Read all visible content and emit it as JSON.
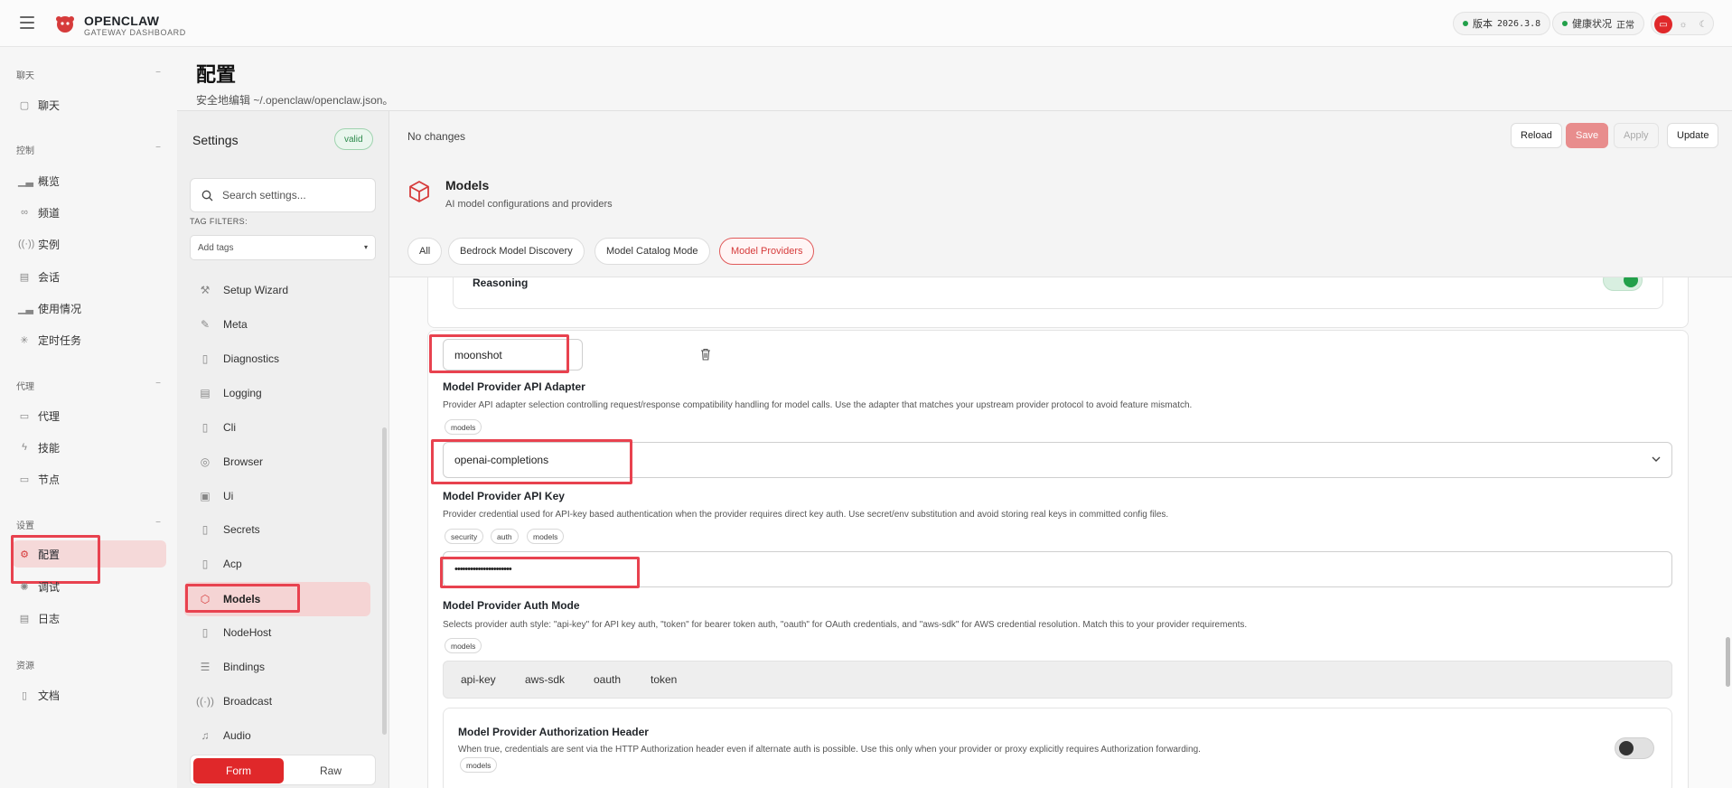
{
  "app": {
    "brand": "OPENCLAW",
    "brand_sub": "GATEWAY DASHBOARD"
  },
  "topbar": {
    "version_label": "版本",
    "version_value": "2026.3.8",
    "health_label": "健康状况",
    "health_value": "正常"
  },
  "nav": {
    "sections": [
      {
        "label": "聊天",
        "toggle": "−"
      },
      {
        "label": "控制",
        "toggle": "−"
      },
      {
        "label": "代理",
        "toggle": "−"
      },
      {
        "label": "设置",
        "toggle": "−"
      },
      {
        "label": "资源"
      }
    ],
    "items": [
      {
        "label": "聊天",
        "icon": "chat-icon"
      },
      {
        "label": "概览",
        "icon": "bar-chart-icon"
      },
      {
        "label": "频道",
        "icon": "link-icon"
      },
      {
        "label": "实例",
        "icon": "broadcast-icon"
      },
      {
        "label": "会话",
        "icon": "document-icon"
      },
      {
        "label": "使用情况",
        "icon": "bar-chart-icon"
      },
      {
        "label": "定时任务",
        "icon": "loader-icon"
      },
      {
        "label": "代理",
        "icon": "folder-icon"
      },
      {
        "label": "技能",
        "icon": "bolt-icon"
      },
      {
        "label": "节点",
        "icon": "monitor-icon"
      },
      {
        "label": "配置",
        "icon": "gear-icon",
        "active": true
      },
      {
        "label": "调试",
        "icon": "bug-icon"
      },
      {
        "label": "日志",
        "icon": "log-icon"
      },
      {
        "label": "文档",
        "icon": "book-icon"
      }
    ]
  },
  "page": {
    "title": "配置",
    "subtitle": "安全地编辑 ~/.openclaw/openclaw.json。"
  },
  "settings": {
    "title": "Settings",
    "status": "valid",
    "search_placeholder": "Search settings...",
    "tag_filters_label": "TAG FILTERS:",
    "add_tags": "Add tags",
    "items": [
      {
        "label": "Setup Wizard",
        "icon": "wand-icon"
      },
      {
        "label": "Meta",
        "icon": "pencil-icon"
      },
      {
        "label": "Diagnostics",
        "icon": "file-icon"
      },
      {
        "label": "Logging",
        "icon": "file-text-icon"
      },
      {
        "label": "Cli",
        "icon": "file-icon"
      },
      {
        "label": "Browser",
        "icon": "chrome-icon"
      },
      {
        "label": "Ui",
        "icon": "layout-icon"
      },
      {
        "label": "Secrets",
        "icon": "file-icon"
      },
      {
        "label": "Acp",
        "icon": "file-icon"
      },
      {
        "label": "Models",
        "icon": "cube-icon",
        "active": true
      },
      {
        "label": "NodeHost",
        "icon": "file-icon"
      },
      {
        "label": "Bindings",
        "icon": "stack-icon"
      },
      {
        "label": "Broadcast",
        "icon": "broadcast-icon"
      },
      {
        "label": "Audio",
        "icon": "music-icon"
      }
    ],
    "mode_form": "Form",
    "mode_raw": "Raw"
  },
  "toolbar": {
    "status": "No changes",
    "reload": "Reload",
    "save": "Save",
    "apply": "Apply",
    "update": "Update"
  },
  "section": {
    "title": "Models",
    "desc": "AI model configurations and providers",
    "tabs": [
      "All",
      "Bedrock Model Discovery",
      "Model Catalog Mode",
      "Model Providers"
    ],
    "active_tab": "Model Providers"
  },
  "form": {
    "reasoning_label": "Reasoning",
    "provider_name": "moonshot",
    "api_adapter": {
      "label": "Model Provider API Adapter",
      "desc": "Provider API adapter selection controlling request/response compatibility handling for model calls. Use the adapter that matches your upstream provider protocol to avoid feature mismatch.",
      "tags": [
        "models"
      ],
      "value": "openai-completions"
    },
    "api_key": {
      "label": "Model Provider API Key",
      "desc": "Provider credential used for API-key based authentication when the provider requires direct key auth. Use secret/env substitution and avoid storing real keys in committed config files.",
      "tags": [
        "security",
        "auth",
        "models"
      ],
      "value": "••••••••••••••••••••••"
    },
    "auth_mode": {
      "label": "Model Provider Auth Mode",
      "desc": "Selects provider auth style: \"api-key\" for API key auth, \"token\" for bearer token auth, \"oauth\" for OAuth credentials, and \"aws-sdk\" for AWS credential resolution. Match this to your provider requirements.",
      "tags": [
        "models"
      ],
      "options": [
        "api-key",
        "aws-sdk",
        "oauth",
        "token"
      ]
    },
    "auth_header": {
      "label": "Model Provider Authorization Header",
      "desc": "When true, credentials are sent via the HTTP Authorization header even if alternate auth is possible. Use this only when your provider or proxy explicitly requires Authorization forwarding.",
      "tags": [
        "models"
      ],
      "enabled": false
    }
  },
  "colors": {
    "accent": "#e0282a",
    "highlight": "#e8424f",
    "success": "#22a04a"
  }
}
